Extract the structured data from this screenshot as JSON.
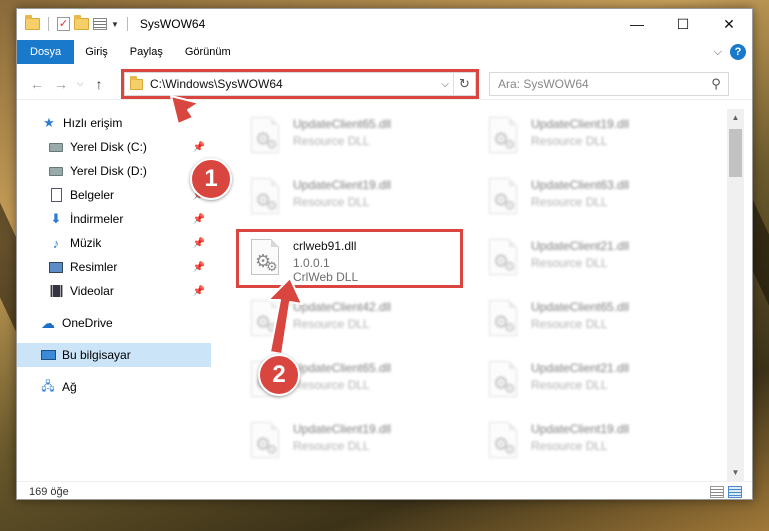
{
  "window": {
    "title": "SysWOW64",
    "controls": {
      "minimize": "—",
      "maximize": "☐",
      "close": "✕"
    }
  },
  "ribbon": {
    "tabs": [
      "Dosya",
      "Giriş",
      "Paylaş",
      "Görünüm"
    ],
    "help": "?"
  },
  "address_bar": {
    "path": "C:\\Windows\\SysWOW64"
  },
  "search": {
    "placeholder": "Ara: SysWOW64"
  },
  "sidebar": {
    "quick_access": "Hızlı erişim",
    "items": [
      {
        "label": "Yerel Disk (C:)",
        "icon": "drive-icon",
        "pinned": true
      },
      {
        "label": "Yerel Disk (D:)",
        "icon": "drive-icon",
        "pinned": false
      },
      {
        "label": "Belgeler",
        "icon": "documents-icon",
        "pinned": true
      },
      {
        "label": "İndirmeler",
        "icon": "downloads-icon",
        "pinned": true
      },
      {
        "label": "Müzik",
        "icon": "music-icon",
        "pinned": true
      },
      {
        "label": "Resimler",
        "icon": "pictures-icon",
        "pinned": true
      },
      {
        "label": "Videolar",
        "icon": "videos-icon",
        "pinned": true
      }
    ],
    "onedrive": "OneDrive",
    "this_pc": "Bu bilgisayar",
    "network": "Ağ"
  },
  "files": [
    {
      "name": "UpdateClient65.dll",
      "sub": "Resource DLL",
      "col": 0,
      "row": 0,
      "blurred": true
    },
    {
      "name": "UpdateClient19.dll",
      "sub": "Resource DLL",
      "col": 1,
      "row": 0,
      "blurred": true
    },
    {
      "name": "UpdateClient19.dll",
      "sub": "Resource DLL",
      "col": 0,
      "row": 1,
      "blurred": true
    },
    {
      "name": "UpdateClient63.dll",
      "sub": "Resource DLL",
      "col": 1,
      "row": 1,
      "blurred": true
    },
    {
      "name": "crlweb91.dll",
      "version": "1.0.0.1",
      "sub": "CrlWeb DLL",
      "col": 0,
      "row": 2,
      "blurred": false
    },
    {
      "name": "UpdateClient21.dll",
      "sub": "Resource DLL",
      "col": 1,
      "row": 2,
      "blurred": true
    },
    {
      "name": "UpdateClient42.dll",
      "sub": "Resource DLL",
      "col": 0,
      "row": 3,
      "blurred": true
    },
    {
      "name": "UpdateClient65.dll",
      "sub": "Resource DLL",
      "col": 1,
      "row": 3,
      "blurred": true
    },
    {
      "name": "UpdateClient65.dll",
      "sub": "Resource DLL",
      "col": 0,
      "row": 4,
      "blurred": true
    },
    {
      "name": "UpdateClient21.dll",
      "sub": "Resource DLL",
      "col": 1,
      "row": 4,
      "blurred": true
    },
    {
      "name": "UpdateClient19.dll",
      "sub": "Resource DLL",
      "col": 0,
      "row": 5,
      "blurred": true
    },
    {
      "name": "UpdateClient19.dll",
      "sub": "Resource DLL",
      "col": 1,
      "row": 5,
      "blurred": true
    }
  ],
  "status": {
    "item_count": "169 öğe"
  },
  "annotations": {
    "step1": "1",
    "step2": "2",
    "color": "#d9453f"
  }
}
